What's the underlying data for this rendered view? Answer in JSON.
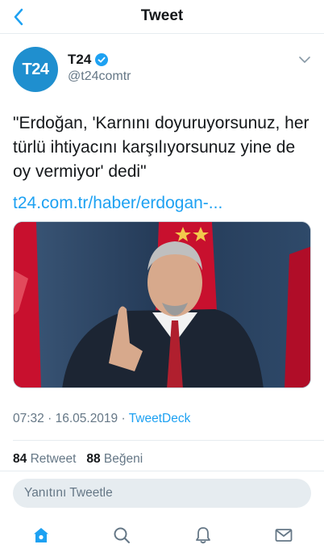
{
  "header": {
    "title": "Tweet",
    "back_icon": "chevron-left-icon"
  },
  "colors": {
    "accent": "#1da1f2",
    "secondary_text": "#657786",
    "avatar_bg": "#1f8fcf"
  },
  "tweet": {
    "avatar_text": "T24",
    "display_name": "T24",
    "verified": true,
    "handle": "@t24comtr",
    "text": "\"Erdoğan, 'Karnını doyuruyorsunuz, her türlü ihtiyacını karşılıyorsunuz yine de oy vermiyor' dedi\"",
    "link": "t24.com.tr/haber/erdogan-...",
    "time": "07:32",
    "date": "16.05.2019",
    "separator": "·",
    "source": "TweetDeck",
    "retweet_count": "84",
    "retweet_label": "Retweet",
    "like_count": "88",
    "like_label": "Beğeni"
  },
  "reply": {
    "placeholder": "Yanıtını Tweetle"
  },
  "tabbar": {
    "items": [
      {
        "icon": "home-icon",
        "active": true
      },
      {
        "icon": "search-icon",
        "active": false
      },
      {
        "icon": "bell-icon",
        "active": false
      },
      {
        "icon": "mail-icon",
        "active": false
      }
    ]
  }
}
